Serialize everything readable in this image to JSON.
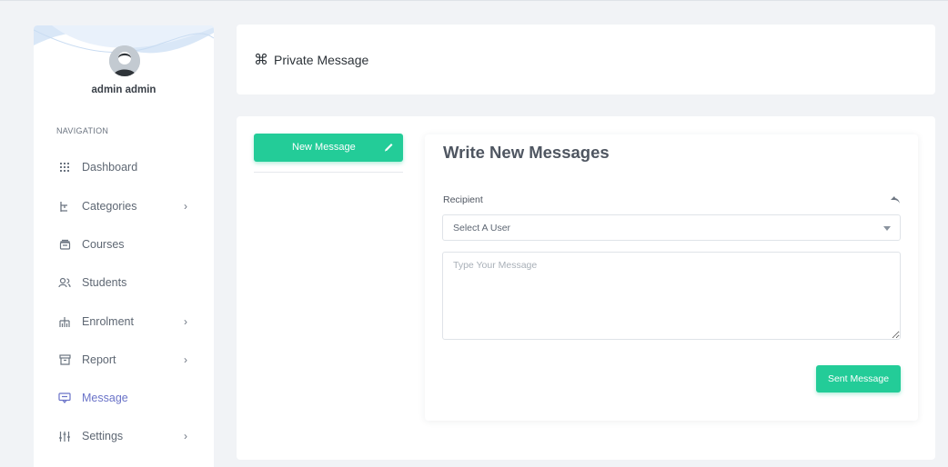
{
  "user": {
    "name": "admin admin"
  },
  "sidebar": {
    "heading": "NAVIGATION",
    "items": [
      {
        "label": "Dashboard",
        "icon": "dashboard-grid-icon",
        "has_submenu": false,
        "active": false
      },
      {
        "label": "Categories",
        "icon": "hierarchy-icon",
        "has_submenu": true,
        "active": false
      },
      {
        "label": "Courses",
        "icon": "courses-icon",
        "has_submenu": false,
        "active": false
      },
      {
        "label": "Students",
        "icon": "students-icon",
        "has_submenu": false,
        "active": false
      },
      {
        "label": "Enrolment",
        "icon": "enrolment-icon",
        "has_submenu": true,
        "active": false
      },
      {
        "label": "Report",
        "icon": "report-icon",
        "has_submenu": true,
        "active": false
      },
      {
        "label": "Message",
        "icon": "message-icon",
        "has_submenu": false,
        "active": true
      },
      {
        "label": "Settings",
        "icon": "settings-sliders-icon",
        "has_submenu": true,
        "active": false
      }
    ],
    "chevron": "›"
  },
  "header": {
    "icon_glyph": "⌘",
    "title": "Private Message"
  },
  "left_panel": {
    "new_message_label": "New Message"
  },
  "compose": {
    "title": "Write New Messages",
    "recipient_label": "Recipient",
    "select_value": "Select A User",
    "message_placeholder": "Type Your Message",
    "send_label": "Sent Message"
  },
  "colors": {
    "accent": "#23cc98",
    "active_nav": "#6a73c8",
    "background": "#f1f3f6"
  }
}
